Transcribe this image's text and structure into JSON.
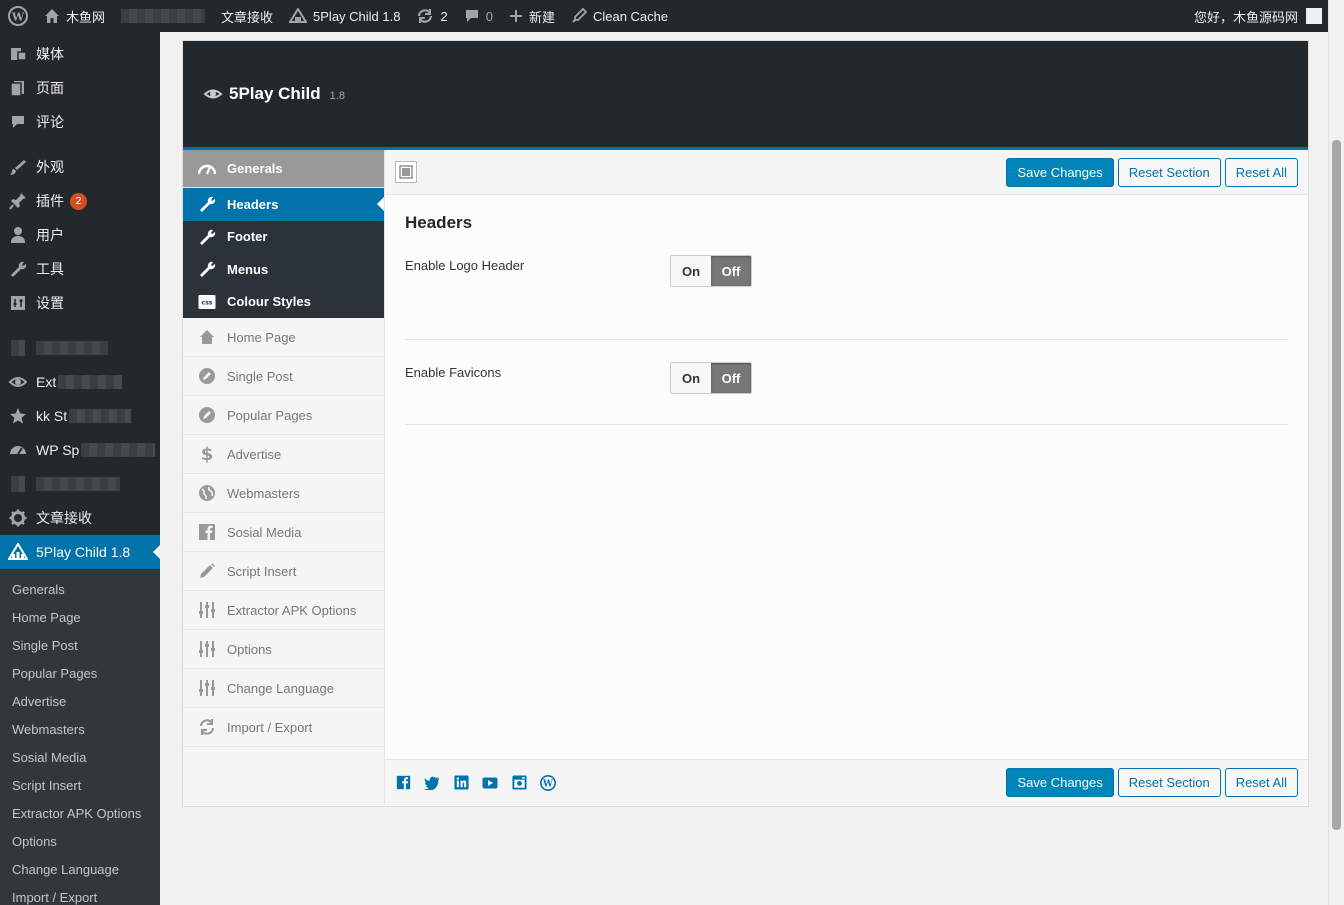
{
  "adminbar": {
    "site_name": "木鱼网",
    "item_posts": "文章接收",
    "theme": "5Play Child 1.8",
    "updates": "2",
    "comments": "0",
    "new": "新建",
    "clean_cache": "Clean Cache",
    "greeting": "您好，木鱼源码网"
  },
  "menu": {
    "items": [
      {
        "label": "媒体",
        "icon": "media-icon"
      },
      {
        "label": "页面",
        "icon": "pages-icon"
      },
      {
        "label": "评论",
        "icon": "comments-icon"
      },
      {
        "label": "外观",
        "icon": "appearance-icon"
      },
      {
        "label": "插件",
        "icon": "plugins-icon",
        "badge": "2"
      },
      {
        "label": "用户",
        "icon": "users-icon"
      },
      {
        "label": "工具",
        "icon": "tools-icon"
      },
      {
        "label": "设置",
        "icon": "settings-icon"
      },
      {
        "label": "Ext",
        "icon": "eye-icon"
      },
      {
        "label": "kk St",
        "icon": "star-icon"
      },
      {
        "label": "WP Sp",
        "icon": "dashboard-icon"
      },
      {
        "label": "文章接收",
        "icon": "gear-icon"
      },
      {
        "label": "5Play Child 1.8",
        "icon": "theme-icon"
      }
    ],
    "submenu": [
      "Generals",
      "Home Page",
      "Single Post",
      "Popular Pages",
      "Advertise",
      "Webmasters",
      "Sosial Media",
      "Script Insert",
      "Extractor APK Options",
      "Options",
      "Change Language",
      "Import / Export"
    ]
  },
  "panel": {
    "title": "5Play Child",
    "version": "1.8",
    "nav": {
      "generals": "Generals",
      "sub": [
        "Headers",
        "Footer",
        "Menus",
        "Colour Styles"
      ],
      "items": [
        "Home Page",
        "Single Post",
        "Popular Pages",
        "Advertise",
        "Webmasters",
        "Sosial Media",
        "Script Insert",
        "Extractor APK Options",
        "Options",
        "Change Language",
        "Import / Export"
      ]
    },
    "buttons": {
      "save": "Save Changes",
      "reset_section": "Reset Section",
      "reset_all": "Reset All"
    },
    "section_title": "Headers",
    "fields": [
      {
        "label": "Enable Logo Header",
        "on": "On",
        "off": "Off",
        "value": "Off"
      },
      {
        "label": "Enable Favicons",
        "on": "On",
        "off": "Off",
        "value": "Off"
      }
    ],
    "social": [
      "facebook-icon",
      "twitter-icon",
      "linkedin-icon",
      "youtube-icon",
      "instagram-icon",
      "wordpress-icon"
    ]
  }
}
